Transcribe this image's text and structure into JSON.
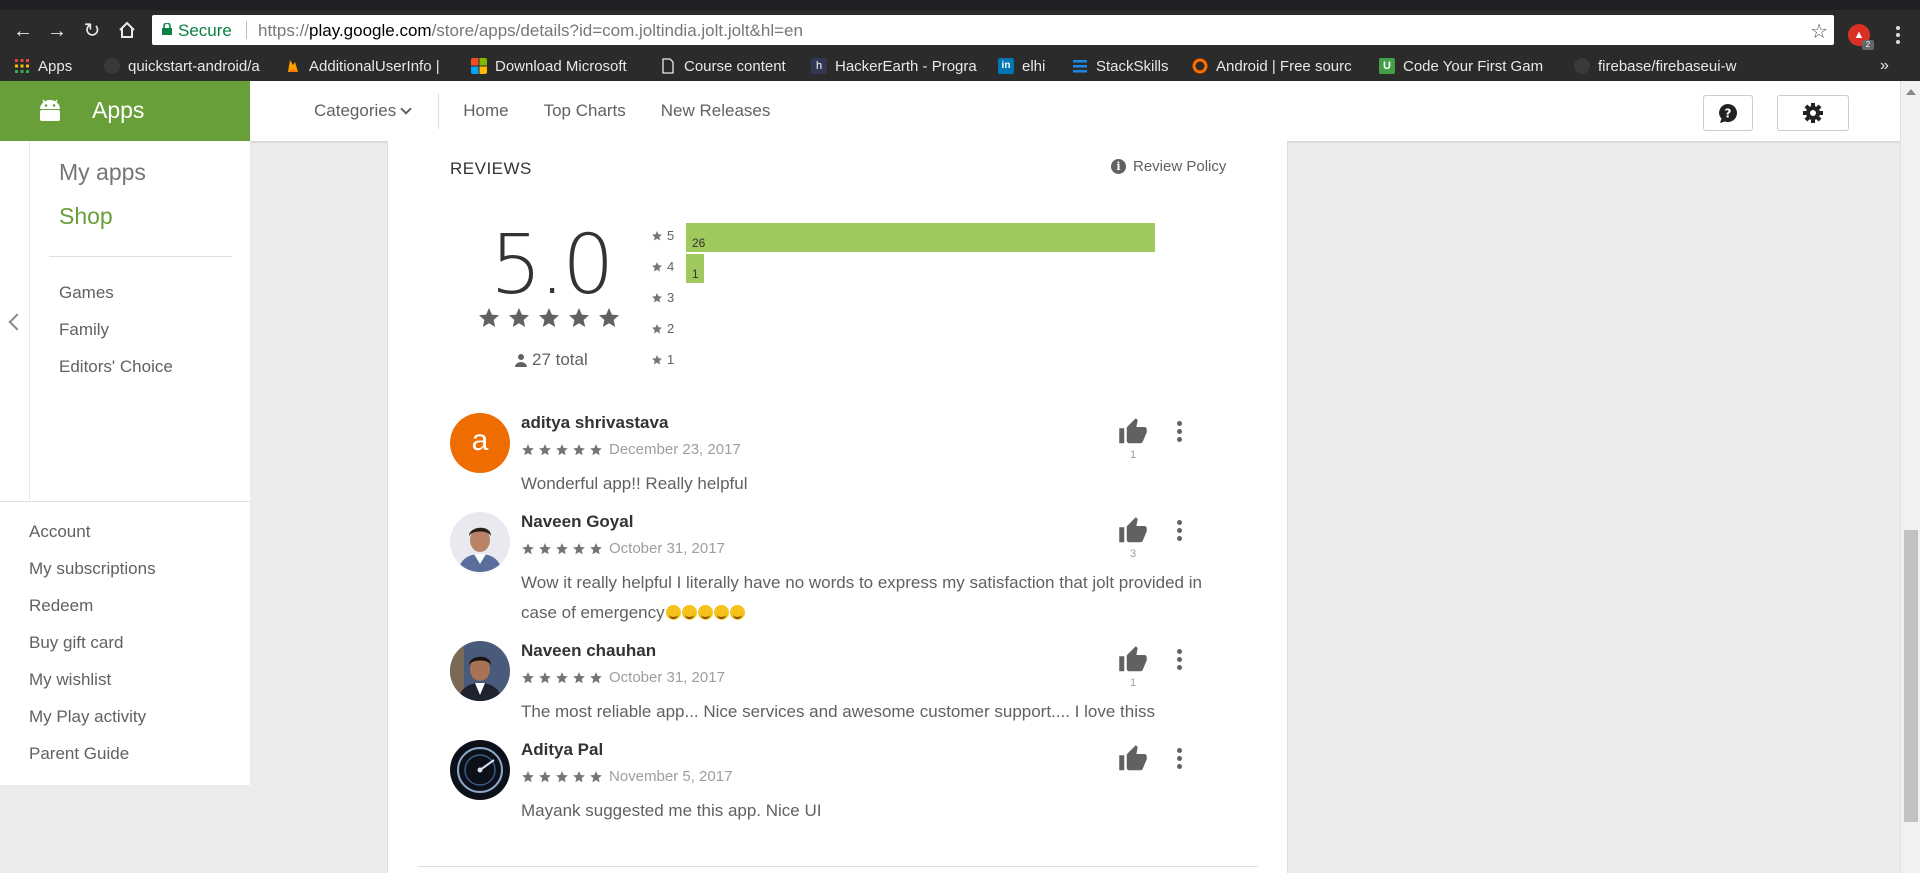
{
  "browser": {
    "secure_label": "Secure",
    "url_scheme": "https://",
    "url_host": "play.google.com",
    "url_path": "/store/apps/details?id=com.joltindia.jolt.jolt&hl=en",
    "extension_badge": "2"
  },
  "bookmarks": [
    {
      "label": "Apps",
      "icon": "apps-grid-icon",
      "color": "#e8453c"
    },
    {
      "label": "quickstart-android/a",
      "icon": "github-icon",
      "color": "#333333"
    },
    {
      "label": "AdditionalUserInfo |",
      "icon": "firebase-icon",
      "color": "#ffa000"
    },
    {
      "label": "Download Microsoft",
      "icon": "microsoft-icon",
      "color": "#f25022"
    },
    {
      "label": "Course content",
      "icon": "page-icon",
      "color": "#ffffff"
    },
    {
      "label": "HackerEarth - Progra",
      "icon": "hackerearth-icon",
      "color": "#323754"
    },
    {
      "label": "elhi",
      "icon": "linkedin-icon",
      "color": "#0077b5"
    },
    {
      "label": "StackSkills",
      "icon": "stackskills-icon",
      "color": "#1e88e5"
    },
    {
      "label": "Android | Free sourc",
      "icon": "android-source-icon",
      "color": "#ff6d00"
    },
    {
      "label": "Code Your First Gam",
      "icon": "udemy-icon",
      "color": "#43a047"
    },
    {
      "label": "firebase/firebaseui-w",
      "icon": "github-icon",
      "color": "#333333"
    }
  ],
  "header": {
    "brand": "Apps",
    "categories": "Categories",
    "nav": [
      "Home",
      "Top Charts",
      "New Releases"
    ],
    "brand_color": "#689f38"
  },
  "left_nav": {
    "my_apps": "My apps",
    "shop": "Shop",
    "categories": [
      "Games",
      "Family",
      "Editors' Choice"
    ],
    "account_links": [
      "Account",
      "My subscriptions",
      "Redeem",
      "Buy gift card",
      "My wishlist",
      "My Play activity",
      "Parent Guide"
    ]
  },
  "reviews": {
    "title": "REVIEWS",
    "policy_label": "Review Policy",
    "score": "5.0",
    "total": "27 total",
    "histogram": [
      {
        "stars": "5",
        "count": "26",
        "value": 26
      },
      {
        "stars": "4",
        "count": "1",
        "value": 1
      },
      {
        "stars": "3",
        "count": "",
        "value": 0
      },
      {
        "stars": "2",
        "count": "",
        "value": 0
      },
      {
        "stars": "1",
        "count": "",
        "value": 0
      }
    ],
    "bar_color": "#9fc95c",
    "items": [
      {
        "name": "aditya shrivastava",
        "date": "December 23, 2017",
        "text": "Wonderful app!! Really helpful",
        "likes": "1",
        "avatar_letter": "a",
        "avatar_color": "#ef6c00"
      },
      {
        "name": "Naveen Goyal",
        "date": "October 31, 2017",
        "text": "Wow it really helpful I literally have no words to express my satisfaction that jolt provided in case of emergency",
        "likes": "3"
      },
      {
        "name": "Naveen chauhan",
        "date": "October 31, 2017",
        "text": "The most reliable app... Nice services and awesome customer support.... I love thiss",
        "likes": "1"
      },
      {
        "name": "Aditya Pal",
        "date": "November 5, 2017",
        "text": "Mayank suggested me this app. Nice UI",
        "likes": ""
      }
    ]
  }
}
